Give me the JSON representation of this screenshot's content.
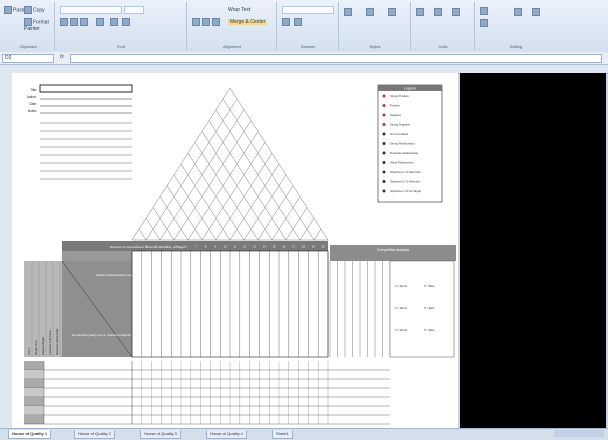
{
  "ribbon": {
    "clipboard": {
      "paste": "Paste",
      "copy": "Copy",
      "format_painter": "Format Painter",
      "label": "Clipboard"
    },
    "font_label": "Font",
    "alignment_label": "Alignment",
    "number_label": "Number",
    "styles_label": "Styles",
    "cells_label": "Cells",
    "editing_label": "Editing",
    "wrap_text": "Wrap Text",
    "merge_center": "Merge & Center"
  },
  "formula_bar": {
    "name_box": "D2",
    "fx": "fx"
  },
  "house": {
    "meta_labels": [
      "Title:",
      "Author:",
      "Date:",
      "Notes:"
    ],
    "legend_title": "Legend",
    "legend_items": [
      "Strong Positive",
      "Positive",
      "Negative",
      "Strong Negative",
      "Not Correlated",
      "Strong Relationship",
      "Moderate Relationship",
      "Weak Relationship",
      "Objective Is To Maximize",
      "Objective Is To Minimize",
      "Objective Is To Hit Target"
    ],
    "direction_label": "Direction of Improvement: Minimize, Maximize, or Target",
    "comp_header": "Competitive Analysis",
    "rating_labels": [
      "0 = Worst",
      "5 = Best"
    ],
    "hows_label": "Column #",
    "whats_block": "Quality Characteristics (a.k.a. Functional Requirements or Hows)",
    "demanded_block": "Demanded Quality (a.k.a. Customer Requirements or Whats)",
    "row_header_labels": [
      "Row #",
      "Weight Chart",
      "Relative Weight",
      "Customer Importance",
      "Maximum Relationship"
    ]
  },
  "tabs": [
    "House of Quality 1",
    "House of Quality 2",
    "House of Quality 3",
    "House of Quality 4",
    "Sheet1"
  ],
  "active_tab": 0
}
